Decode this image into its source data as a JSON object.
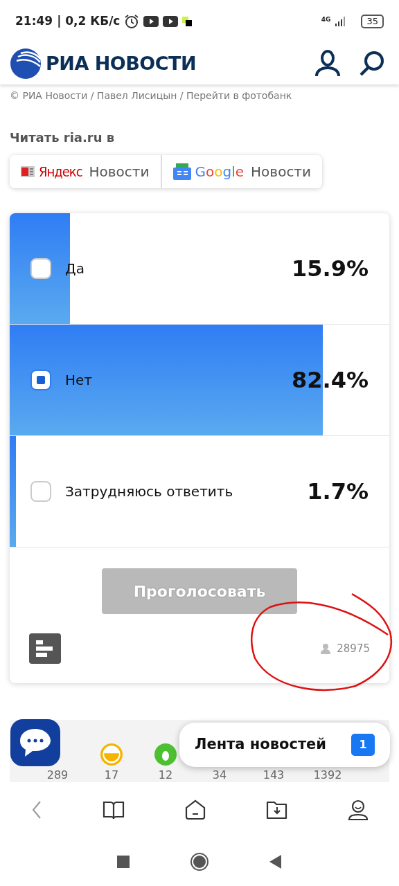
{
  "status_bar": {
    "time": "21:49",
    "speed": "| 0,2 КБ/с",
    "network": "4G",
    "battery": "35"
  },
  "header": {
    "logo": "РИА НОВОСТИ"
  },
  "photo_credit": "© РИА Новости / Павел Лисицын / Перейти в фотобанк",
  "read_in": {
    "title": "Читать ria.ru в",
    "sources": [
      {
        "kind": "yandex",
        "brand": "Яндекс",
        "label": "Новости"
      },
      {
        "kind": "google",
        "brand": "Google",
        "label": "Новости"
      }
    ]
  },
  "poll": {
    "options": [
      {
        "label": "Да",
        "percent": "15.9%",
        "level": 0.159,
        "selected": false
      },
      {
        "label": "Нет",
        "percent": "82.4%",
        "level": 0.824,
        "selected": true
      },
      {
        "label": "Затрудняюсь ответить",
        "percent": "1.7%",
        "level": 0.017,
        "selected": false
      }
    ],
    "vote_button": {
      "label": "Проголосовать",
      "disabled": true
    },
    "voters": "28975"
  },
  "reactions": [
    {
      "kind": "hidden",
      "count": "289"
    },
    {
      "kind": "laugh",
      "count": "17"
    },
    {
      "kind": "green",
      "count": "12"
    },
    {
      "kind": "hidden",
      "count": "34"
    },
    {
      "kind": "hidden",
      "count": "143"
    },
    {
      "kind": "hidden",
      "count": "1392"
    }
  ],
  "news_feed": {
    "label": "Лента новостей",
    "badge": "1"
  }
}
